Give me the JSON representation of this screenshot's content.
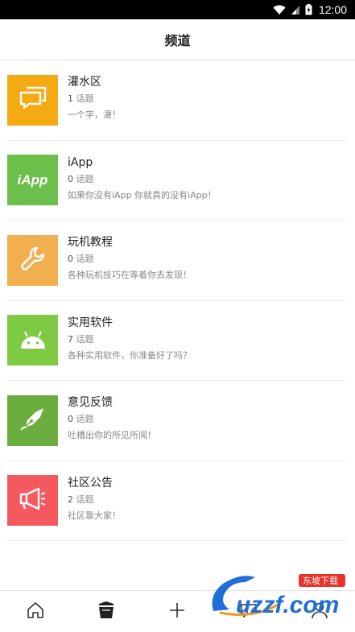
{
  "status": {
    "time": "12:00"
  },
  "header": {
    "title": "频道"
  },
  "channels": [
    {
      "name": "灌水区",
      "count": "1",
      "count_suffix": "话题",
      "desc": "一个字，灌！",
      "color": "#F5A912",
      "icon": "chat-bubbles-icon"
    },
    {
      "name": "iApp",
      "count": "0",
      "count_suffix": "话题",
      "desc": "如果你没有iApp 你就真的没有iApp！",
      "color": "#6CBF4A",
      "icon": "iapp-logo-icon",
      "logo_text": "iApp"
    },
    {
      "name": "玩机教程",
      "count": "0",
      "count_suffix": "话题",
      "desc": "各种玩机技巧在等着你去发现！",
      "color": "#F2AF4F",
      "icon": "wrench-icon"
    },
    {
      "name": "实用软件",
      "count": "7",
      "count_suffix": "话题",
      "desc": "各种实用软件，你准备好了吗？",
      "color": "#7ECA43",
      "icon": "android-icon"
    },
    {
      "name": "意见反馈",
      "count": "0",
      "count_suffix": "话题",
      "desc": "吐槽出你的所见所闻！",
      "color": "#6BAD3F",
      "icon": "pen-nib-icon"
    },
    {
      "name": "社区公告",
      "count": "2",
      "count_suffix": "话题",
      "desc": "社区靠大家！",
      "color": "#F5585F",
      "icon": "megaphone-icon"
    }
  ],
  "tabs": [
    {
      "icon": "home-icon"
    },
    {
      "icon": "channel-icon",
      "active": true
    },
    {
      "icon": "plus-icon"
    },
    {
      "icon": "message-icon"
    },
    {
      "icon": "profile-icon"
    }
  ],
  "watermark": {
    "text": "uzzf.com",
    "tag": "东坡下载"
  }
}
